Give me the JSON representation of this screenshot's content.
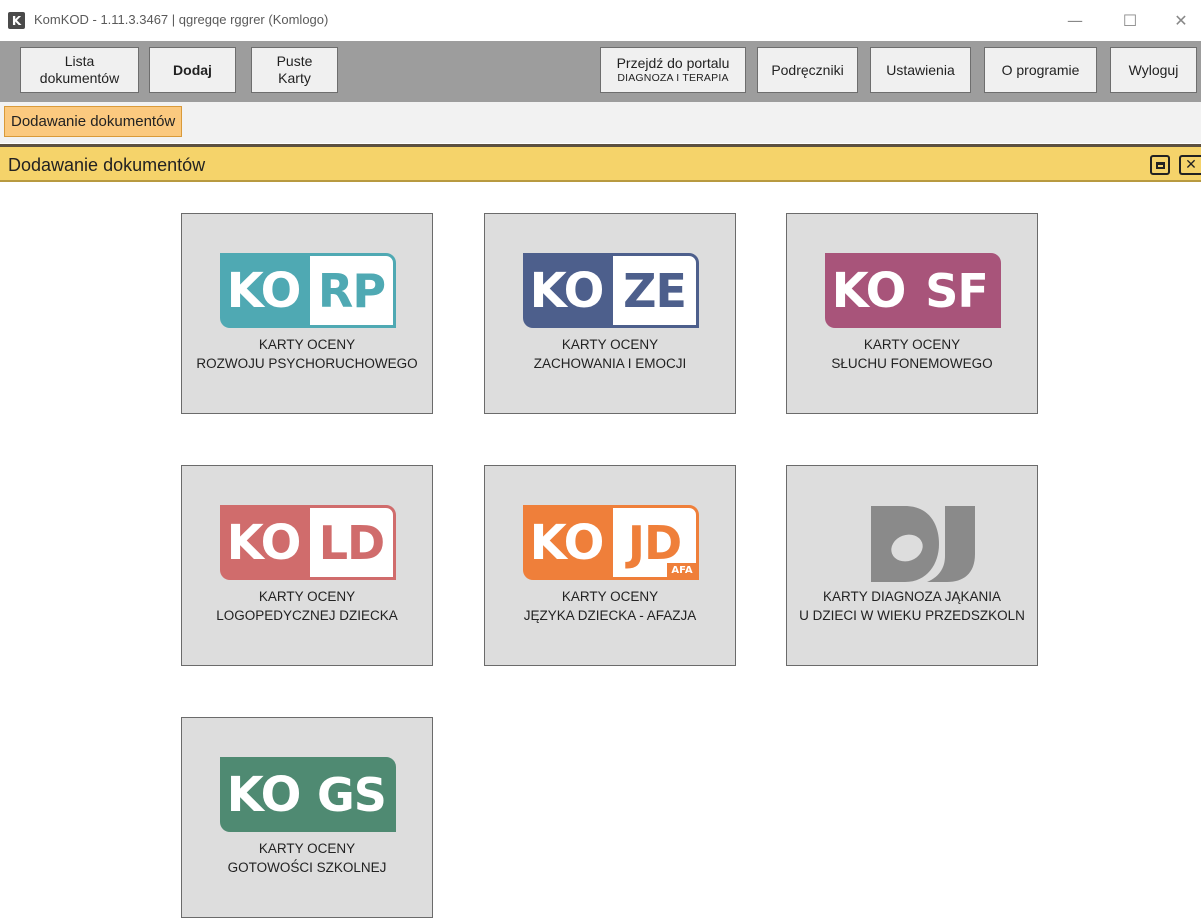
{
  "window": {
    "icon_letter": "K",
    "title": "KomKOD - 1.11.3.3467 | qgregqe rggrer (Komlogo)",
    "minimize_glyph": "—",
    "maximize_glyph": "☐",
    "close_glyph": "✕"
  },
  "toolbar": {
    "lista_line1": "Lista",
    "lista_line2": "dokumentów",
    "dodaj": "Dodaj",
    "puste_line1": "Puste",
    "puste_line2": "Karty",
    "portal_line1": "Przejdź do portalu",
    "portal_line2": "DIAGNOZA I TERAPIA",
    "podreczniki": "Podręczniki",
    "ustawienia": "Ustawienia",
    "o_programie": "O programie",
    "wyloguj": "Wyloguj"
  },
  "tabs": {
    "active": "Dodawanie dokumentów"
  },
  "panel": {
    "title": "Dodawanie dokumentów",
    "close_glyph": "✕"
  },
  "colors": {
    "korp": "#4fa9b3",
    "koze": "#4d5f8c",
    "kosf": "#a8547a",
    "kold": "#d06c6c",
    "kojd": "#ef7f3a",
    "kogs": "#4f8a72",
    "dj": "#8a8a8a"
  },
  "cards": [
    {
      "left": "KO",
      "right": "RP",
      "line1": "KARTY OCENY",
      "line2": "ROZWOJU PSYCHORUCHOWEGO"
    },
    {
      "left": "KO",
      "right": "ZE",
      "line1": "KARTY OCENY",
      "line2": "ZACHOWANIA I EMOCJI"
    },
    {
      "left": "KO",
      "right": "SF",
      "line1": "KARTY OCENY",
      "line2": "SŁUCHU FONEMOWEGO"
    },
    {
      "left": "KO",
      "right": "LD",
      "line1": "KARTY OCENY",
      "line2": "LOGOPEDYCZNEJ DZIECKA"
    },
    {
      "left": "KO",
      "right": "JD",
      "badge": "AFA",
      "line1": "KARTY OCENY",
      "line2": "JĘZYKA DZIECKA - AFAZJA"
    },
    {
      "left": "DJ",
      "line1": "KARTY DIAGNOZA JĄKANIA",
      "line2": "U DZIECI W WIEKU PRZEDSZKOLN"
    },
    {
      "left": "KO",
      "right": "GS",
      "line1": "KARTY OCENY",
      "line2": "GOTOWOŚCI SZKOLNEJ"
    }
  ]
}
